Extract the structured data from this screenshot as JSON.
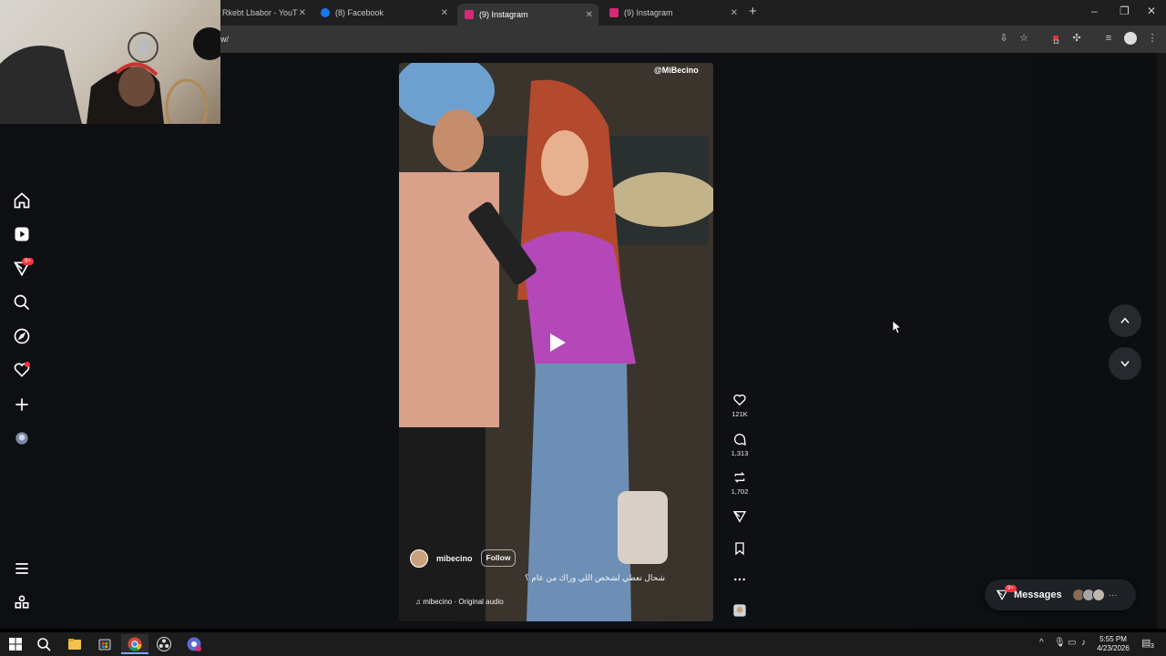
{
  "browser": {
    "tabs": [
      {
        "title": "Rkebt Lbabor - YouT",
        "color": "#ff0000"
      },
      {
        "title": "(8) Facebook",
        "color": "#1877f2"
      },
      {
        "title": "(9) Instagram",
        "color": "#d62976",
        "active": true
      },
      {
        "title": "(9) Instagram",
        "color": "#d62976"
      }
    ],
    "url": "w/",
    "extension_badge": "12"
  },
  "sidebar": {
    "notifications_badge": "9+"
  },
  "reel": {
    "watermark": "@MiBecino",
    "author": "mibecino",
    "follow_label": "Follow",
    "caption": "شحال تعطي لشخص اللي وراك من عام ؟",
    "audio": "mibecino · Original audio",
    "likes": "121K",
    "comments": "1,313",
    "reposts": "1,702"
  },
  "messages": {
    "label": "Messages",
    "badge": "9+"
  },
  "taskbar": {
    "time": "5:55 PM",
    "date": "4/23/2026",
    "notif_count": "3"
  }
}
